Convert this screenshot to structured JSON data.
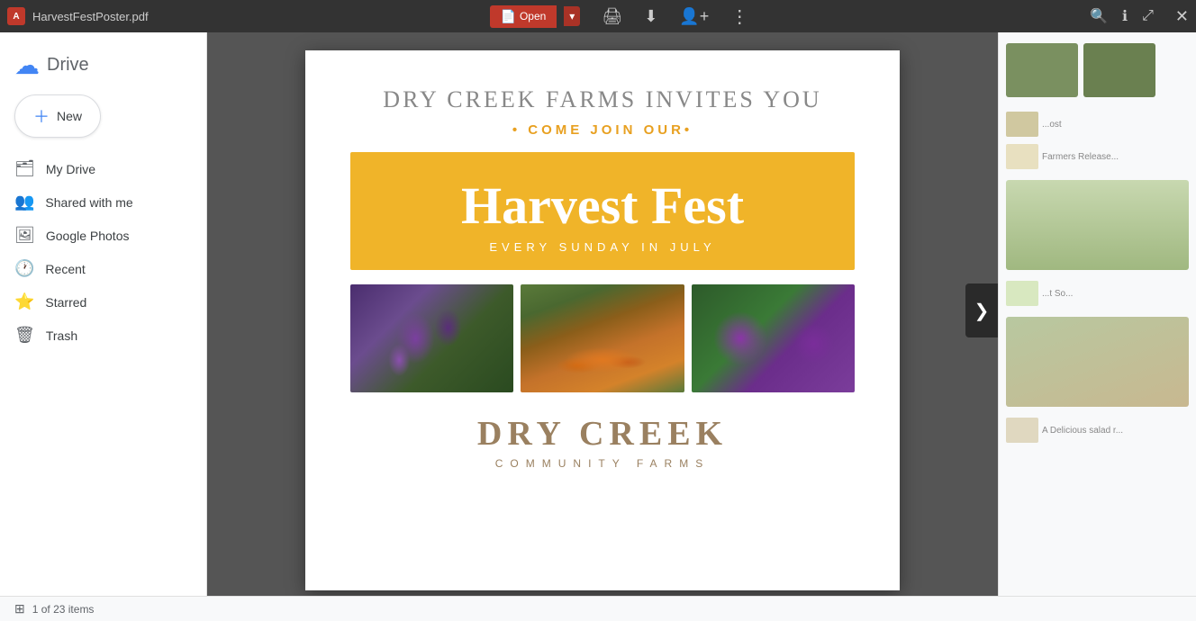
{
  "app": {
    "filename": "HarvestFestPoster.pdf",
    "logo_label": "A"
  },
  "toolbar": {
    "open_label": "Open",
    "print_icon": "🖨",
    "download_icon": "⬇",
    "share_icon": "👤+",
    "more_icon": "⋮",
    "zoom_in_icon": "🔍+",
    "info_icon": "ℹ",
    "popout_icon": "⬡",
    "close_icon": "✕"
  },
  "sidebar": {
    "logo_icon": "☁",
    "logo_text": "Drive",
    "new_button": "New",
    "items": [
      {
        "id": "my-drive",
        "label": "My Drive",
        "icon": "🗂"
      },
      {
        "id": "shared",
        "label": "Shared with me",
        "icon": "👥"
      },
      {
        "id": "photos",
        "label": "Google Photos",
        "icon": "🖼"
      },
      {
        "id": "recent",
        "label": "Recent",
        "icon": "🕐"
      },
      {
        "id": "starred",
        "label": "Starred",
        "icon": "⭐"
      },
      {
        "id": "trash",
        "label": "Trash",
        "icon": "🗑"
      }
    ]
  },
  "pdf": {
    "main_title": "DRY CREEK FARMS INVITES YOU",
    "subtitle": "COME JOIN OUR",
    "banner_title": "Harvest Fest",
    "banner_subtitle": "EVERY SUNDAY IN JULY",
    "farm_name": "DRY CREEK",
    "farm_sub": "COMMUNITY FARMS",
    "banner_color": "#f0b429",
    "subtitle_color": "#e8a020"
  },
  "status": {
    "page_count": "1 of 23 items",
    "grid_icon": "⊞"
  },
  "right_panel": {
    "items": [
      {
        "label": "...ost",
        "desc": ""
      },
      {
        "label": "Farmers Release...",
        "desc": ""
      },
      {
        "label": "...t So...",
        "desc": ""
      },
      {
        "label": "A Delicious salad r...",
        "desc": ""
      }
    ]
  },
  "nav": {
    "next_arrow": "❯"
  }
}
